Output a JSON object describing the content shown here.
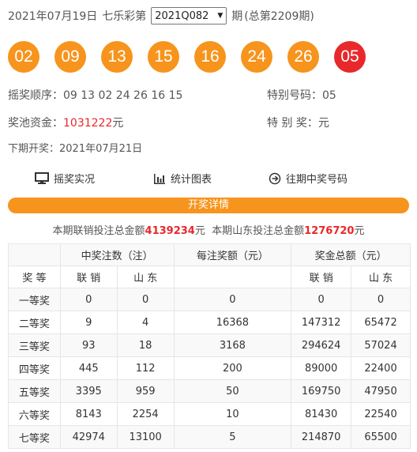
{
  "header": {
    "date": "2021年07月19日",
    "lottery_name": "七乐彩第",
    "issue_selected": "2021Q082",
    "issue_suffix": "期",
    "total_issue": "(总第2209期)"
  },
  "balls": {
    "regular": [
      "02",
      "09",
      "13",
      "15",
      "16",
      "24",
      "26"
    ],
    "special": "05",
    "regular_color": "#f7941d",
    "special_color": "#e8282b"
  },
  "draw_info": {
    "order_label": "摇奖顺序：",
    "order_value": "09 13 02 24 26 16 15",
    "special_label": "特别号码：",
    "special_value": "05",
    "pool_label": "奖池资金：",
    "pool_value": "1031222",
    "pool_unit": "元",
    "special_prize_label": "特 别 奖：",
    "special_prize_value": "元",
    "next_draw_label": "下期开奖：",
    "next_draw_value": "2021年07月21日"
  },
  "links": {
    "live": "摇奖实况",
    "chart": "统计图表",
    "history": "往期中奖号码"
  },
  "details_bar": "开奖详情",
  "sales": {
    "prefix": "本期联销投注总金额",
    "joint_value": "4139234",
    "unit1": "元",
    "mid": "  本期山东投注总金额",
    "shandong_value": "1276720",
    "unit2": "元"
  },
  "table": {
    "header_count": "中奖注数（注）",
    "header_each": "每注奖额（元）",
    "header_total": "奖金总额（元）",
    "col_level": "奖 等",
    "col_joint": "联 销",
    "col_sd": "山 东",
    "rows": [
      {
        "level": "一等奖",
        "count_joint": "0",
        "count_sd": "0",
        "each": "0",
        "total_joint": "0",
        "total_sd": "0"
      },
      {
        "level": "二等奖",
        "count_joint": "9",
        "count_sd": "4",
        "each": "16368",
        "total_joint": "147312",
        "total_sd": "65472"
      },
      {
        "level": "三等奖",
        "count_joint": "93",
        "count_sd": "18",
        "each": "3168",
        "total_joint": "294624",
        "total_sd": "57024"
      },
      {
        "level": "四等奖",
        "count_joint": "445",
        "count_sd": "112",
        "each": "200",
        "total_joint": "89000",
        "total_sd": "22400"
      },
      {
        "level": "五等奖",
        "count_joint": "3395",
        "count_sd": "959",
        "each": "50",
        "total_joint": "169750",
        "total_sd": "47950"
      },
      {
        "level": "六等奖",
        "count_joint": "8143",
        "count_sd": "2254",
        "each": "10",
        "total_joint": "81430",
        "total_sd": "22540"
      },
      {
        "level": "七等奖",
        "count_joint": "42974",
        "count_sd": "13100",
        "each": "5",
        "total_joint": "214870",
        "total_sd": "65500"
      }
    ]
  }
}
